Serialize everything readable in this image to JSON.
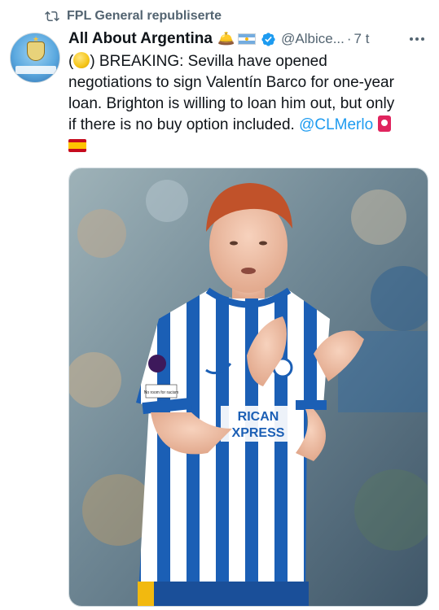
{
  "repost": {
    "icon": "repost-icon",
    "text": "FPL General republiserte"
  },
  "author": {
    "name": "All About Argentina",
    "badge_emoji": "🛎️",
    "flag": "argentina-flag-icon",
    "handle": "@Albice...",
    "separator": "·",
    "time": "7 t",
    "verified": true
  },
  "tweet": {
    "line1_after_emoji": ") BREAKING: Sevilla have opened",
    "line1_before_emoji": "(",
    "line2": "negotiations to sign Valentín Barco for one-year",
    "line3": "loan. Brighton is willing to loan him out, but only",
    "line4_text": "if there is no buy option included. ",
    "line4_mention": "@CLMerlo"
  },
  "media": {
    "shirt_sponsor_line1": "RICAN",
    "shirt_sponsor_line2": "XPRESS",
    "sleeve_patch": "No room for racism"
  },
  "colors": {
    "link": "#1d9bf0",
    "verified": "#1d9bf0",
    "secondary_text": "#536471",
    "brighton_blue": "#1b5fb5"
  }
}
